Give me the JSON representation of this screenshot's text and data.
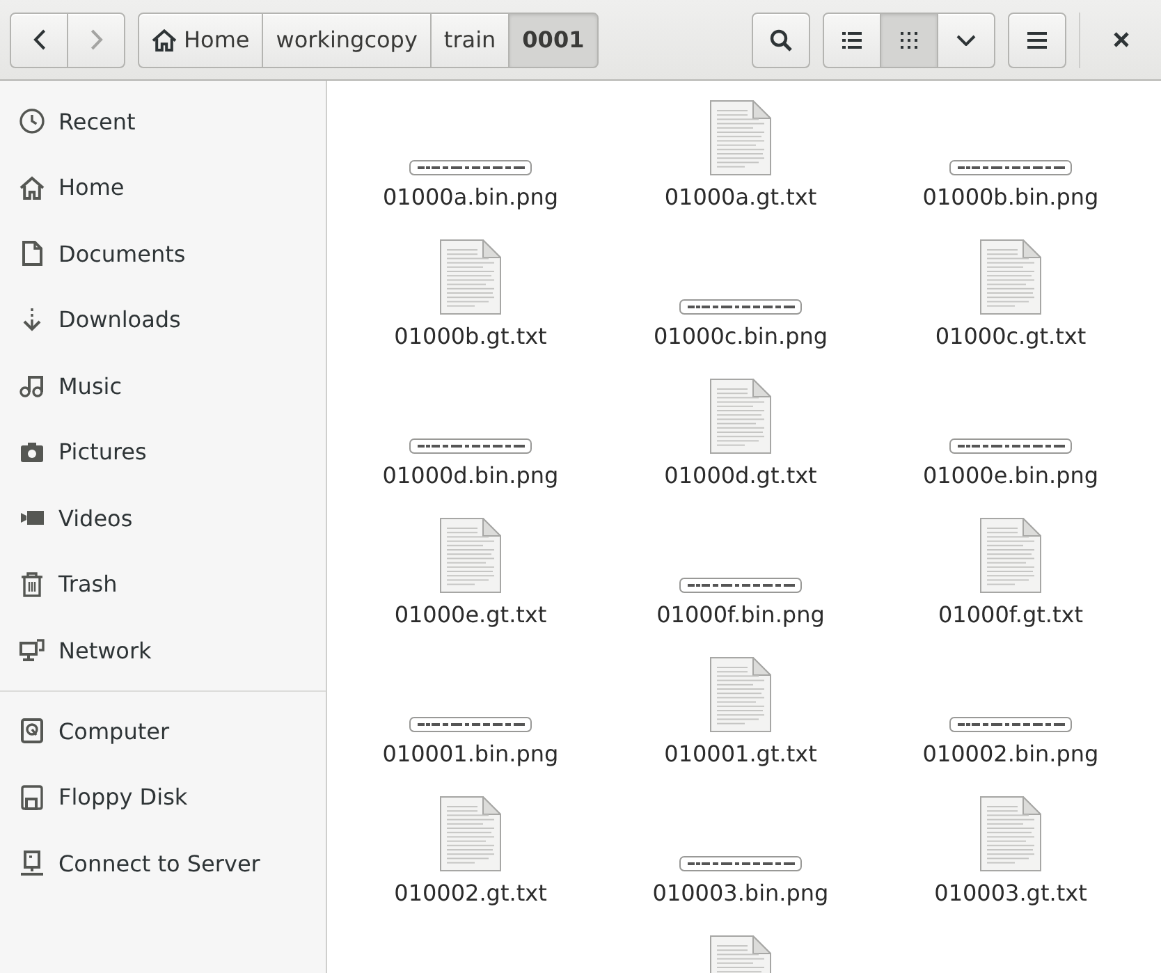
{
  "toolbar": {
    "navigation": [
      {
        "kind": "back",
        "disabled": false
      },
      {
        "kind": "forward",
        "disabled": true
      }
    ],
    "path": [
      {
        "kind": "home",
        "label": "Home",
        "selected": false
      },
      {
        "kind": "folder",
        "label": "workingcopy",
        "selected": false
      },
      {
        "kind": "folder",
        "label": "train",
        "selected": false
      },
      {
        "kind": "folder",
        "label": "0001",
        "selected": true
      }
    ],
    "view_modes": [
      {
        "kind": "list",
        "selected": false
      },
      {
        "kind": "grid",
        "selected": true
      }
    ]
  },
  "sidebar": {
    "sections": [
      {
        "items": [
          {
            "kind": "recent",
            "label": "Recent"
          },
          {
            "kind": "home",
            "label": "Home"
          },
          {
            "kind": "documents",
            "label": "Documents"
          },
          {
            "kind": "downloads",
            "label": "Downloads"
          },
          {
            "kind": "music",
            "label": "Music"
          },
          {
            "kind": "pictures",
            "label": "Pictures"
          },
          {
            "kind": "videos",
            "label": "Videos"
          },
          {
            "kind": "trash",
            "label": "Trash"
          },
          {
            "kind": "network",
            "label": "Network"
          }
        ]
      },
      {
        "items": [
          {
            "kind": "computer",
            "label": "Computer"
          },
          {
            "kind": "floppy",
            "label": "Floppy Disk"
          },
          {
            "kind": "server",
            "label": "Connect to Server"
          }
        ]
      }
    ]
  },
  "files": [
    {
      "kind": "image",
      "name": "01000a.bin.png"
    },
    {
      "kind": "text",
      "name": "01000a.gt.txt"
    },
    {
      "kind": "image",
      "name": "01000b.bin.png"
    },
    {
      "kind": "text",
      "name": "01000b.gt.txt"
    },
    {
      "kind": "image",
      "name": "01000c.bin.png"
    },
    {
      "kind": "text",
      "name": "01000c.gt.txt"
    },
    {
      "kind": "image",
      "name": "01000d.bin.png"
    },
    {
      "kind": "text",
      "name": "01000d.gt.txt"
    },
    {
      "kind": "image",
      "name": "01000e.bin.png"
    },
    {
      "kind": "text",
      "name": "01000e.gt.txt"
    },
    {
      "kind": "image",
      "name": "01000f.bin.png"
    },
    {
      "kind": "text",
      "name": "01000f.gt.txt"
    },
    {
      "kind": "image",
      "name": "010001.bin.png"
    },
    {
      "kind": "text",
      "name": "010001.gt.txt"
    },
    {
      "kind": "image",
      "name": "010002.bin.png"
    },
    {
      "kind": "text",
      "name": "010002.gt.txt"
    },
    {
      "kind": "image",
      "name": "010003.bin.png"
    },
    {
      "kind": "text",
      "name": "010003.gt.txt"
    },
    {
      "kind": "blank"
    },
    {
      "kind": "text"
    }
  ]
}
